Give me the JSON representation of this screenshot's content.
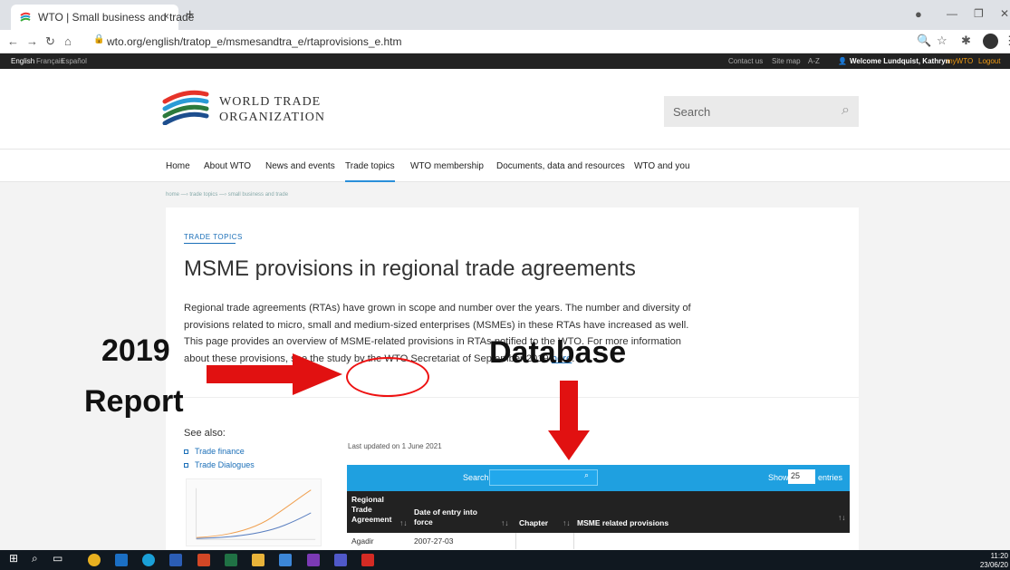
{
  "browser": {
    "tab_title": "WTO | Small business and trade",
    "tab_close": "×",
    "new_tab": "+",
    "url": "wto.org/english/tratop_e/msmesandtra_e/rtaprovisions_e.htm"
  },
  "topbar": {
    "languages": [
      "English",
      "Français",
      "Español"
    ],
    "links": [
      "Contact us",
      "Site map",
      "A-Z"
    ],
    "welcome": "Welcome Lundquist, Kathryn",
    "mywto": "myWTO",
    "logout": "Logout"
  },
  "header": {
    "logo_line1": "WORLD TRADE",
    "logo_line2": "ORGANIZATION",
    "search_placeholder": "Search"
  },
  "nav": {
    "items": [
      "Home",
      "About WTO",
      "News and events",
      "Trade topics",
      "WTO membership",
      "Documents, data and resources",
      "WTO and you"
    ],
    "active": "Trade topics"
  },
  "breadcrumb": "home —› trade topics —› small business and trade",
  "content": {
    "eyebrow": "TRADE TOPICS",
    "title": "MSME provisions in regional trade agreements",
    "para_1": "Regional trade agreements (RTAs) have grown in scope and number over the years. The number and diversity of provisions related to micro, small and medium-sized enterprises (MSMEs) in these RTAs have increased as well. This page provides an overview of MSME-related provisions in RTAs notified to the WTO. For more information about these provisions, see the study by the WTO Secretariat of September 2019",
    "para_link": "here",
    "para_end": "."
  },
  "see_also": {
    "heading": "See also:",
    "links": [
      "Trade finance",
      "Trade Dialogues"
    ]
  },
  "table": {
    "updated": "Last updated on 1 June 2021",
    "search_label": "Search:",
    "show": "Show",
    "show_value": "25",
    "entries": "entries",
    "headers": [
      "Regional Trade Agreement",
      "Date of entry into force",
      "Chapter",
      "MSME related provisions"
    ],
    "rows": [
      [
        "Agadir",
        "2007-27-03",
        "",
        ""
      ]
    ]
  },
  "annotations": {
    "year": "2019",
    "report": "Report",
    "database": "Database"
  },
  "taskbar": {
    "time": "11:20",
    "date": "23/06/20"
  },
  "colors": {
    "accent": "#1fa0e0",
    "arrow": "#e11111",
    "link": "#1b6fb8"
  }
}
